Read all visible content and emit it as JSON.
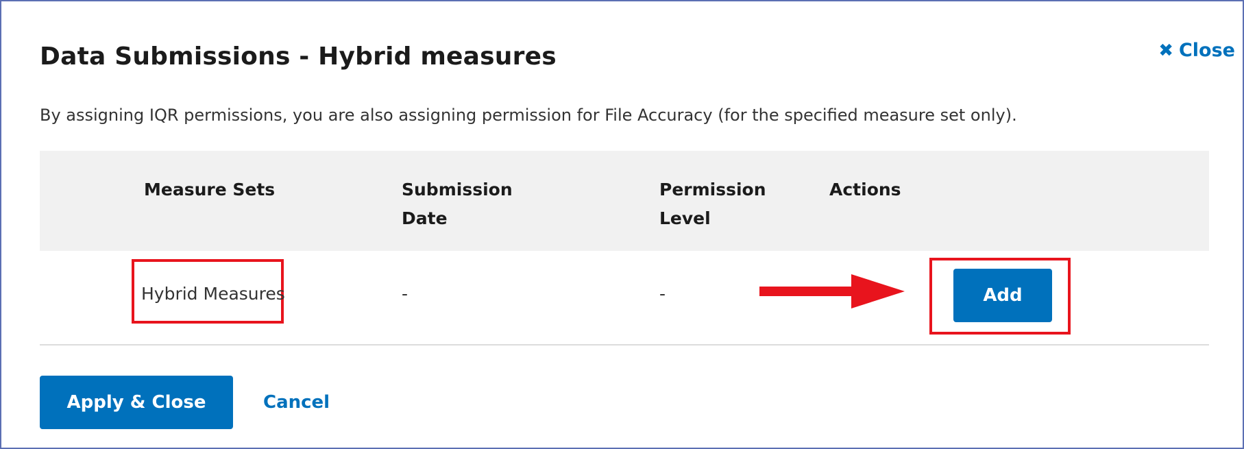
{
  "dialog": {
    "title": "Data Submissions - Hybrid measures",
    "close_label": "Close",
    "description": "By assigning IQR permissions, you are also assigning permission for File Accuracy (for the specified measure set only)."
  },
  "table": {
    "headers": {
      "measure_sets": "Measure Sets",
      "submission_date_line1": "Submission",
      "submission_date_line2": "Date",
      "permission_level_line1": "Permission",
      "permission_level_line2": "Level",
      "actions": "Actions"
    },
    "rows": [
      {
        "measure_set": "Hybrid Measures",
        "submission_date": "-",
        "permission_level": "-",
        "action_label": "Add"
      }
    ]
  },
  "footer": {
    "apply_label": "Apply & Close",
    "cancel_label": "Cancel"
  },
  "colors": {
    "primary": "#0071bc",
    "annotation_red": "#e8141d",
    "header_bg": "#f1f1f1"
  },
  "icons": {
    "close": "x-icon",
    "annotation": "right-arrow-annotation-icon"
  }
}
